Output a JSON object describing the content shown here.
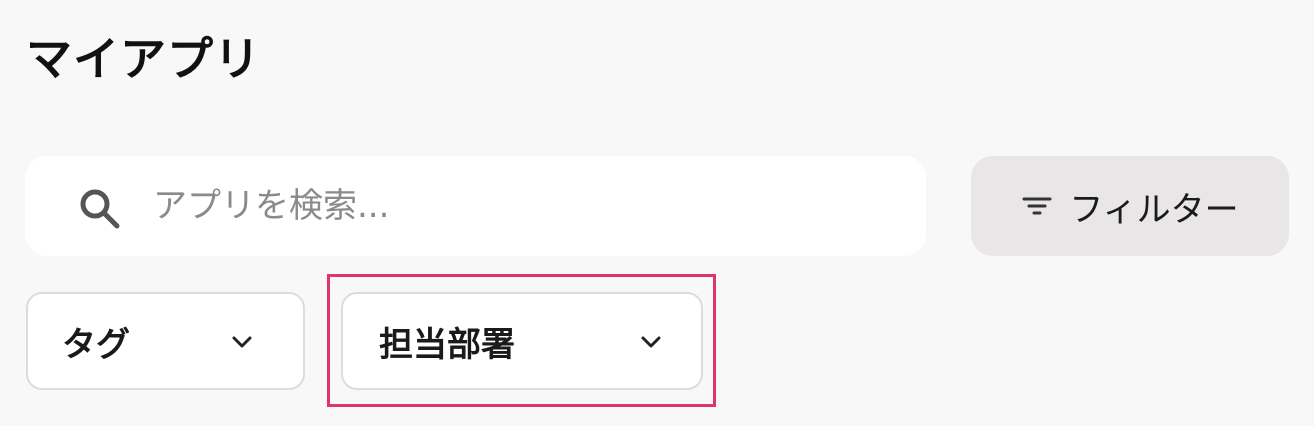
{
  "header": {
    "title": "マイアプリ"
  },
  "search": {
    "placeholder": "アプリを検索...",
    "value": "",
    "icon": "search-icon"
  },
  "filter": {
    "label": "フィルター",
    "icon": "filter-icon"
  },
  "dropdowns": [
    {
      "label": "タグ",
      "icon": "chevron-down-icon"
    },
    {
      "label": "担当部署",
      "icon": "chevron-down-icon"
    }
  ],
  "colors": {
    "background": "#f8f8f8",
    "highlight": "#e0356b",
    "filter_button_bg": "#e8e6e6",
    "card_bg": "#ffffff"
  }
}
